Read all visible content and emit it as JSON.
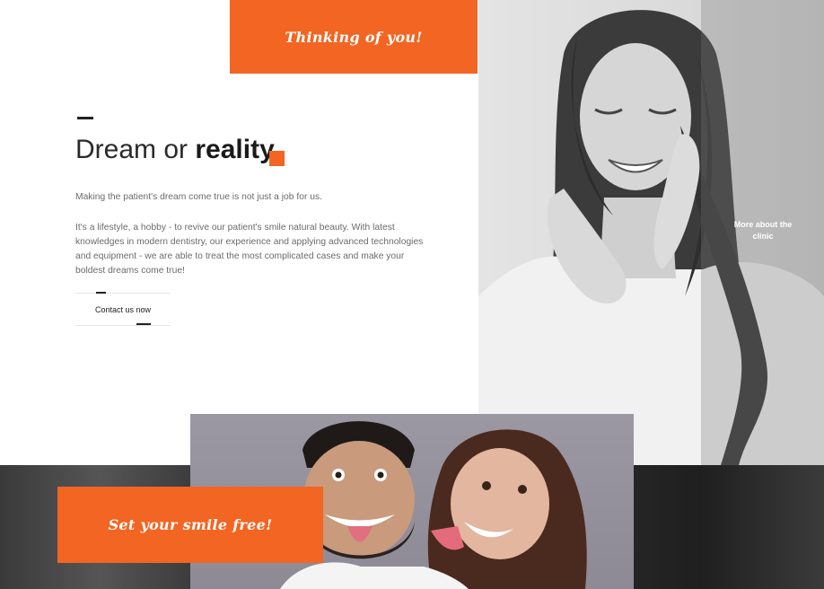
{
  "banner_top": {
    "text": "Thinking of you!"
  },
  "intro": {
    "title_regular": "Dream or ",
    "title_bold": "reality",
    "paragraph_1": "Making the patient's dream come true is not just a job for us.",
    "paragraph_2": "It's a lifestyle, a hobby - to revive our patient's smile natural beauty. With latest knowledges in modern dentistry, our experience and applying advanced technologies and equipment - we are able to treat the most complicated cases and make your boldest dreams come true!",
    "contact_label": "Contact us now"
  },
  "photo_right": {
    "link_label": "More about the clinic"
  },
  "banner_bottom": {
    "text": "Set your smile free!"
  },
  "colors": {
    "accent": "#f26522",
    "text_dark": "#222222",
    "text_muted": "#6b6b6b"
  }
}
